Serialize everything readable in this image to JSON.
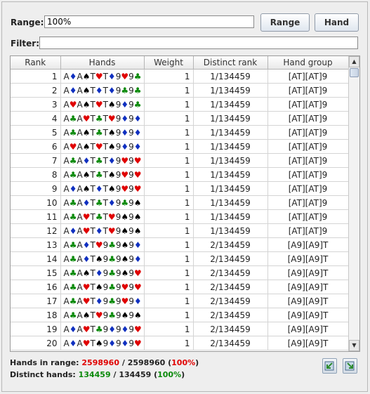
{
  "range": {
    "label": "Range:",
    "value": "100%"
  },
  "filter": {
    "label": "Filter:",
    "value": ""
  },
  "buttons": {
    "range": "Range",
    "hand": "Hand"
  },
  "table": {
    "columns": [
      "Rank",
      "Hands",
      "Weight",
      "Distinct rank",
      "Hand group"
    ],
    "rows": [
      {
        "rank": "1",
        "hand": [
          [
            "A",
            "d"
          ],
          [
            "A",
            "s"
          ],
          [
            "T",
            "h"
          ],
          [
            "T",
            "d"
          ],
          [
            "9",
            "h"
          ],
          [
            "9",
            "c"
          ]
        ],
        "weight": "1",
        "distinct": "1/134459",
        "group": "[AT][AT]9"
      },
      {
        "rank": "2",
        "hand": [
          [
            "A",
            "d"
          ],
          [
            "A",
            "s"
          ],
          [
            "T",
            "d"
          ],
          [
            "T",
            "d"
          ],
          [
            "9",
            "c"
          ],
          [
            "9",
            "c"
          ]
        ],
        "weight": "1",
        "distinct": "1/134459",
        "group": "[AT][AT]9"
      },
      {
        "rank": "3",
        "hand": [
          [
            "A",
            "h"
          ],
          [
            "A",
            "s"
          ],
          [
            "T",
            "h"
          ],
          [
            "T",
            "s"
          ],
          [
            "9",
            "d"
          ],
          [
            "9",
            "c"
          ]
        ],
        "weight": "1",
        "distinct": "1/134459",
        "group": "[AT][AT]9"
      },
      {
        "rank": "4",
        "hand": [
          [
            "A",
            "c"
          ],
          [
            "A",
            "h"
          ],
          [
            "T",
            "c"
          ],
          [
            "T",
            "h"
          ],
          [
            "9",
            "d"
          ],
          [
            "9",
            "d"
          ]
        ],
        "weight": "1",
        "distinct": "1/134459",
        "group": "[AT][AT]9"
      },
      {
        "rank": "5",
        "hand": [
          [
            "A",
            "c"
          ],
          [
            "A",
            "s"
          ],
          [
            "T",
            "c"
          ],
          [
            "T",
            "s"
          ],
          [
            "9",
            "d"
          ],
          [
            "9",
            "d"
          ]
        ],
        "weight": "1",
        "distinct": "1/134459",
        "group": "[AT][AT]9"
      },
      {
        "rank": "6",
        "hand": [
          [
            "A",
            "h"
          ],
          [
            "A",
            "s"
          ],
          [
            "T",
            "h"
          ],
          [
            "T",
            "s"
          ],
          [
            "9",
            "d"
          ],
          [
            "9",
            "d"
          ]
        ],
        "weight": "1",
        "distinct": "1/134459",
        "group": "[AT][AT]9"
      },
      {
        "rank": "7",
        "hand": [
          [
            "A",
            "c"
          ],
          [
            "A",
            "d"
          ],
          [
            "T",
            "c"
          ],
          [
            "T",
            "d"
          ],
          [
            "9",
            "h"
          ],
          [
            "9",
            "h"
          ]
        ],
        "weight": "1",
        "distinct": "1/134459",
        "group": "[AT][AT]9"
      },
      {
        "rank": "8",
        "hand": [
          [
            "A",
            "c"
          ],
          [
            "A",
            "s"
          ],
          [
            "T",
            "c"
          ],
          [
            "T",
            "s"
          ],
          [
            "9",
            "h"
          ],
          [
            "9",
            "h"
          ]
        ],
        "weight": "1",
        "distinct": "1/134459",
        "group": "[AT][AT]9"
      },
      {
        "rank": "9",
        "hand": [
          [
            "A",
            "d"
          ],
          [
            "A",
            "s"
          ],
          [
            "T",
            "d"
          ],
          [
            "T",
            "s"
          ],
          [
            "9",
            "h"
          ],
          [
            "9",
            "h"
          ]
        ],
        "weight": "1",
        "distinct": "1/134459",
        "group": "[AT][AT]9"
      },
      {
        "rank": "10",
        "hand": [
          [
            "A",
            "c"
          ],
          [
            "A",
            "d"
          ],
          [
            "T",
            "c"
          ],
          [
            "T",
            "d"
          ],
          [
            "9",
            "c"
          ],
          [
            "9",
            "s"
          ]
        ],
        "weight": "1",
        "distinct": "1/134459",
        "group": "[AT][AT]9"
      },
      {
        "rank": "11",
        "hand": [
          [
            "A",
            "c"
          ],
          [
            "A",
            "h"
          ],
          [
            "T",
            "c"
          ],
          [
            "T",
            "h"
          ],
          [
            "9",
            "s"
          ],
          [
            "9",
            "s"
          ]
        ],
        "weight": "1",
        "distinct": "1/134459",
        "group": "[AT][AT]9"
      },
      {
        "rank": "12",
        "hand": [
          [
            "A",
            "d"
          ],
          [
            "A",
            "h"
          ],
          [
            "T",
            "d"
          ],
          [
            "T",
            "h"
          ],
          [
            "9",
            "s"
          ],
          [
            "9",
            "s"
          ]
        ],
        "weight": "1",
        "distinct": "1/134459",
        "group": "[AT][AT]9"
      },
      {
        "rank": "13",
        "hand": [
          [
            "A",
            "c"
          ],
          [
            "A",
            "d"
          ],
          [
            "T",
            "h"
          ],
          [
            "9",
            "c"
          ],
          [
            "9",
            "s"
          ],
          [
            "9",
            "d"
          ]
        ],
        "weight": "1",
        "distinct": "2/134459",
        "group": "[A9][A9]T"
      },
      {
        "rank": "14",
        "hand": [
          [
            "A",
            "c"
          ],
          [
            "A",
            "d"
          ],
          [
            "T",
            "s"
          ],
          [
            "9",
            "c"
          ],
          [
            "9",
            "s"
          ],
          [
            "9",
            "d"
          ]
        ],
        "weight": "1",
        "distinct": "2/134459",
        "group": "[A9][A9]T"
      },
      {
        "rank": "15",
        "hand": [
          [
            "A",
            "c"
          ],
          [
            "A",
            "s"
          ],
          [
            "T",
            "d"
          ],
          [
            "9",
            "c"
          ],
          [
            "9",
            "s"
          ],
          [
            "9",
            "h"
          ]
        ],
        "weight": "1",
        "distinct": "2/134459",
        "group": "[A9][A9]T"
      },
      {
        "rank": "16",
        "hand": [
          [
            "A",
            "c"
          ],
          [
            "A",
            "h"
          ],
          [
            "T",
            "s"
          ],
          [
            "9",
            "c"
          ],
          [
            "9",
            "h"
          ],
          [
            "9",
            "h"
          ]
        ],
        "weight": "1",
        "distinct": "2/134459",
        "group": "[A9][A9]T"
      },
      {
        "rank": "17",
        "hand": [
          [
            "A",
            "c"
          ],
          [
            "A",
            "h"
          ],
          [
            "T",
            "d"
          ],
          [
            "9",
            "c"
          ],
          [
            "9",
            "h"
          ],
          [
            "9",
            "d"
          ]
        ],
        "weight": "1",
        "distinct": "2/134459",
        "group": "[A9][A9]T"
      },
      {
        "rank": "18",
        "hand": [
          [
            "A",
            "c"
          ],
          [
            "A",
            "s"
          ],
          [
            "T",
            "h"
          ],
          [
            "9",
            "c"
          ],
          [
            "9",
            "s"
          ],
          [
            "9",
            "s"
          ]
        ],
        "weight": "1",
        "distinct": "2/134459",
        "group": "[A9][A9]T"
      },
      {
        "rank": "19",
        "hand": [
          [
            "A",
            "d"
          ],
          [
            "A",
            "h"
          ],
          [
            "T",
            "c"
          ],
          [
            "9",
            "d"
          ],
          [
            "9",
            "d"
          ],
          [
            "9",
            "h"
          ]
        ],
        "weight": "1",
        "distinct": "2/134459",
        "group": "[A9][A9]T"
      },
      {
        "rank": "20",
        "hand": [
          [
            "A",
            "d"
          ],
          [
            "A",
            "h"
          ],
          [
            "T",
            "s"
          ],
          [
            "9",
            "d"
          ],
          [
            "9",
            "d"
          ],
          [
            "9",
            "h"
          ]
        ],
        "weight": "1",
        "distinct": "2/134459",
        "group": "[A9][A9]T"
      }
    ]
  },
  "stats": {
    "hands_label": "Hands in range:",
    "hands_count": "2598960",
    "hands_sep": "/",
    "hands_total": "2598960",
    "hands_pct": "100%",
    "distinct_label": "Distinct hands:",
    "distinct_count": "134459",
    "distinct_sep": "/",
    "distinct_total": "134459",
    "distinct_pct": "100%"
  },
  "colors": {
    "red": "#e00000",
    "green": "#0a8a0a",
    "diamond_alt": "#1030c0"
  },
  "icons": {
    "import": "import-icon",
    "export": "export-icon"
  }
}
